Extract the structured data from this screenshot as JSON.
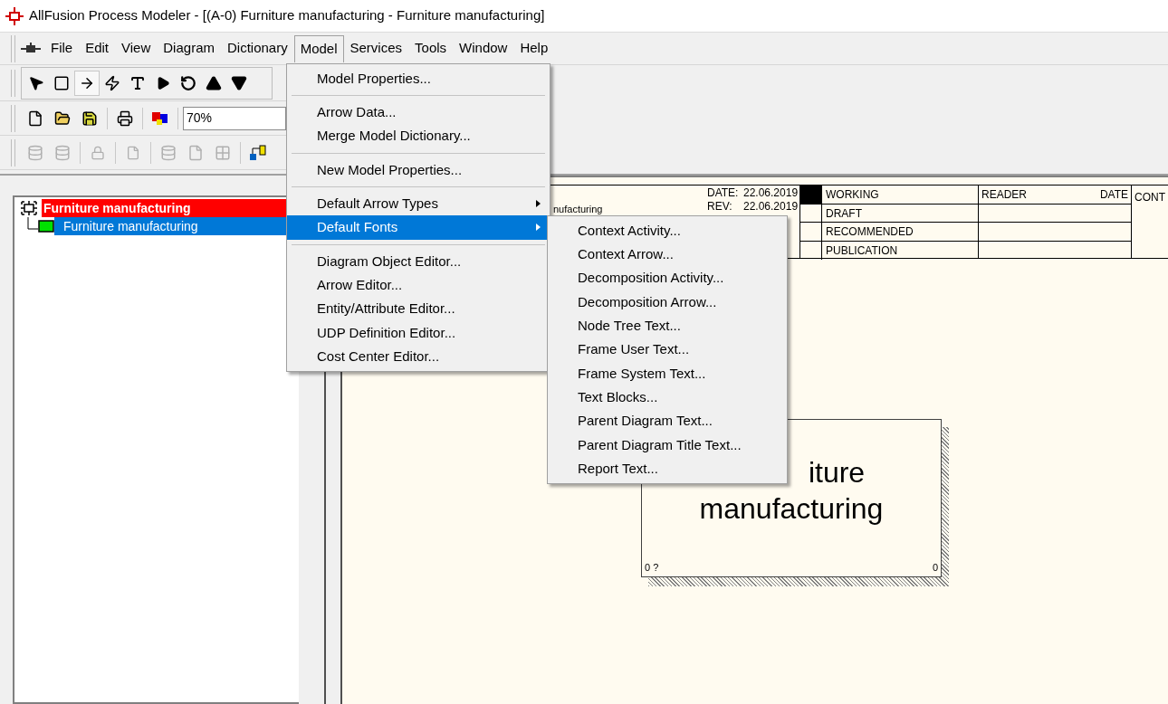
{
  "window": {
    "title": "AllFusion Process Modeler - [(A-0) Furniture manufacturing - Furniture manufacturing]"
  },
  "menu_bar": [
    {
      "label": "File",
      "selected": false
    },
    {
      "label": "Edit",
      "selected": false
    },
    {
      "label": "View",
      "selected": false
    },
    {
      "label": "Diagram",
      "selected": false
    },
    {
      "label": "Dictionary",
      "selected": false
    },
    {
      "label": "Model",
      "selected": true
    },
    {
      "label": "Services",
      "selected": false
    },
    {
      "label": "Tools",
      "selected": false
    },
    {
      "label": "Window",
      "selected": false
    },
    {
      "label": "Help",
      "selected": false
    }
  ],
  "zoom_combo": {
    "value": "70%"
  },
  "tree": [
    {
      "label": "Furniture manufacturing",
      "highlighted": true,
      "selected": false,
      "children": [
        {
          "label": "Furniture manufacturing",
          "selected": true
        }
      ]
    }
  ],
  "model_menu": [
    {
      "kind": "item",
      "label": "Model Properties...",
      "selected": false
    },
    {
      "kind": "separator"
    },
    {
      "kind": "item",
      "label": "Arrow Data...",
      "selected": false
    },
    {
      "kind": "item",
      "label": "Merge Model Dictionary...",
      "selected": false
    },
    {
      "kind": "separator"
    },
    {
      "kind": "item",
      "label": "New Model Properties...",
      "selected": false
    },
    {
      "kind": "separator"
    },
    {
      "kind": "submenu",
      "label": "Default Arrow Types",
      "selected": false
    },
    {
      "kind": "submenu",
      "label": "Default Fonts",
      "selected": true
    },
    {
      "kind": "separator"
    },
    {
      "kind": "item",
      "label": "Diagram Object Editor...",
      "selected": false
    },
    {
      "kind": "item",
      "label": "Arrow Editor...",
      "selected": false
    },
    {
      "kind": "item",
      "label": "Entity/Attribute Editor...",
      "selected": false
    },
    {
      "kind": "item",
      "label": "UDP Definition Editor...",
      "selected": false
    },
    {
      "kind": "item",
      "label": "Cost Center Editor...",
      "selected": false
    }
  ],
  "fonts_submenu": [
    {
      "kind": "item",
      "label": "Context Activity...",
      "selected": false
    },
    {
      "kind": "item",
      "label": "Context Arrow...",
      "selected": false
    },
    {
      "kind": "item",
      "label": "Decomposition Activity...",
      "selected": false
    },
    {
      "kind": "item",
      "label": "Decomposition Arrow...",
      "selected": false
    },
    {
      "kind": "item",
      "label": "Node Tree Text...",
      "selected": false
    },
    {
      "kind": "item",
      "label": "Frame User Text...",
      "selected": false
    },
    {
      "kind": "item",
      "label": "Frame System Text...",
      "selected": false
    },
    {
      "kind": "item",
      "label": "Text Blocks...",
      "selected": false
    },
    {
      "kind": "item",
      "label": "Parent Diagram Text...",
      "selected": false
    },
    {
      "kind": "item",
      "label": "Parent Diagram Title Text...",
      "selected": false
    },
    {
      "kind": "item",
      "label": "Report Text...",
      "selected": false
    }
  ],
  "diagram": {
    "frame": {
      "project_fragment": "nufacturing",
      "date_label": "DATE:",
      "date": "22.06.2019",
      "rev_label": "REV:",
      "rev": "22.06.2019",
      "statuses": [
        {
          "label": "WORKING",
          "selected": true
        },
        {
          "label": "DRAFT",
          "selected": false
        },
        {
          "label": "RECOMMENDED",
          "selected": false
        },
        {
          "label": "PUBLICATION",
          "selected": false
        }
      ],
      "reader": "READER",
      "reader_date": "DATE",
      "context": "CONT"
    },
    "activity": {
      "name_lines": [
        "iture",
        "manufacturing"
      ],
      "left_label": "0 ?",
      "right_label": "0"
    }
  }
}
